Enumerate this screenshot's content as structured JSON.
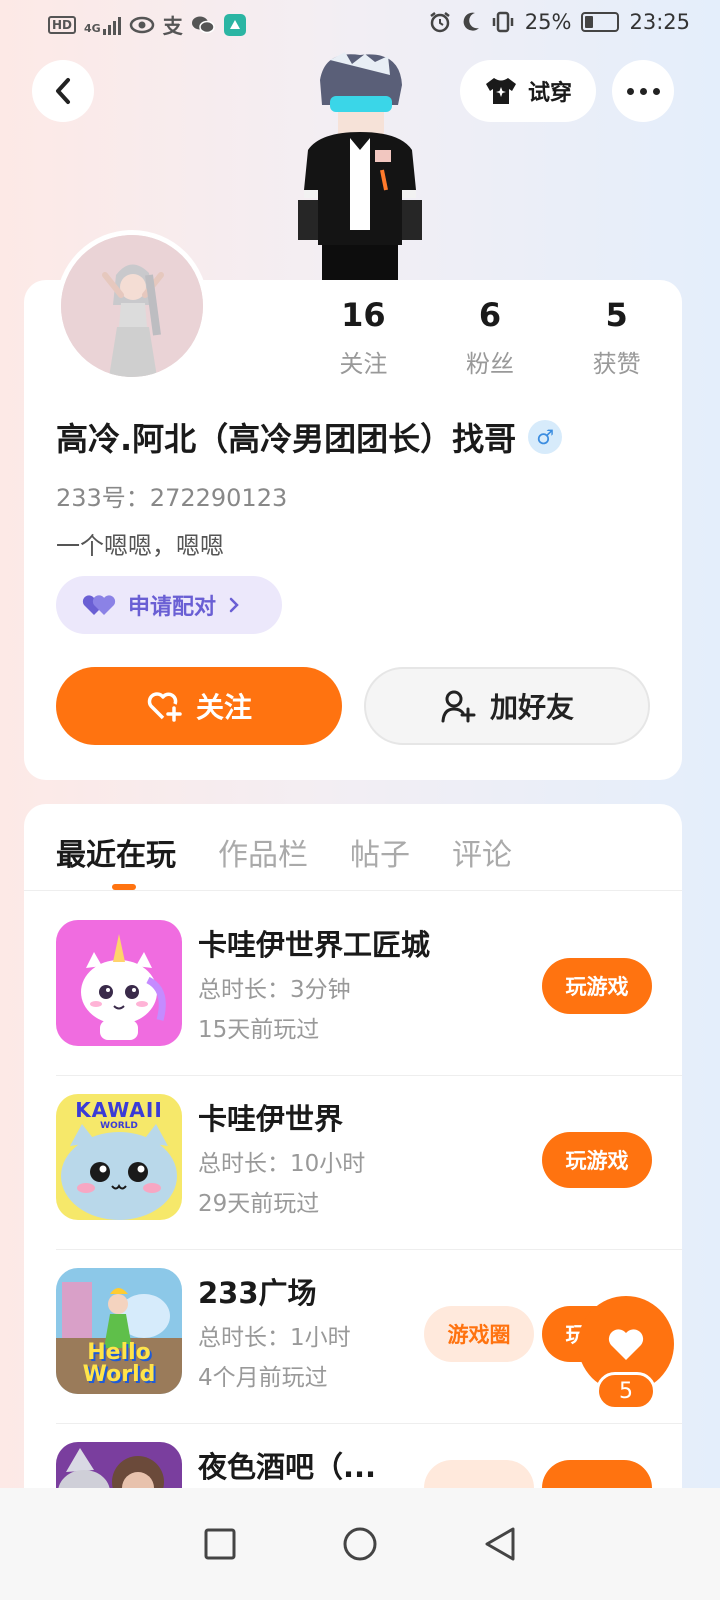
{
  "status_bar": {
    "hd": "HD",
    "network": "4G",
    "alipay_glyph": "支",
    "battery_pct": "25%",
    "time": "23:25"
  },
  "top": {
    "try_on_label": "试穿"
  },
  "profile": {
    "stats": [
      {
        "num": "16",
        "label": "关注"
      },
      {
        "num": "6",
        "label": "粉丝"
      },
      {
        "num": "5",
        "label": "获赞"
      }
    ],
    "nickname": "高冷.阿北（高冷男团团长）找哥",
    "gender_symbol": "♂",
    "uid": "233号：272290123",
    "bio": "一个嗯嗯，嗯嗯",
    "pair_label": "申请配对",
    "follow_label": "关注",
    "add_friend_label": "加好友"
  },
  "tabs": [
    {
      "label": "最近在玩",
      "active": true
    },
    {
      "label": "作品栏",
      "active": false
    },
    {
      "label": "帖子",
      "active": false
    },
    {
      "label": "评论",
      "active": false
    }
  ],
  "games": [
    {
      "name": "卡哇伊世界工匠城",
      "duration": "总时长：3分钟",
      "last": "15天前玩过",
      "play": "玩游戏",
      "icon": "unicorn-icon"
    },
    {
      "name": "卡哇伊世界",
      "duration": "总时长：10小时",
      "last": "29天前玩过",
      "play": "玩游戏",
      "icon": "kawaii-cat-icon",
      "icon_text": "KAWAII",
      "icon_subtext": "WORLD"
    },
    {
      "name": "233广场",
      "duration": "总时长：1小时",
      "last": "4个月前玩过",
      "play": "玩游戏",
      "circle": "游戏圈",
      "icon": "fairy-icon",
      "icon_text": "Hello World"
    },
    {
      "name": "夜色酒吧（...",
      "icon": "bar-girl-icon"
    }
  ],
  "like_count": "5",
  "colors": {
    "accent": "#ff7310",
    "pair_bg": "#ece8fb",
    "pair_text": "#6a5fd4"
  }
}
